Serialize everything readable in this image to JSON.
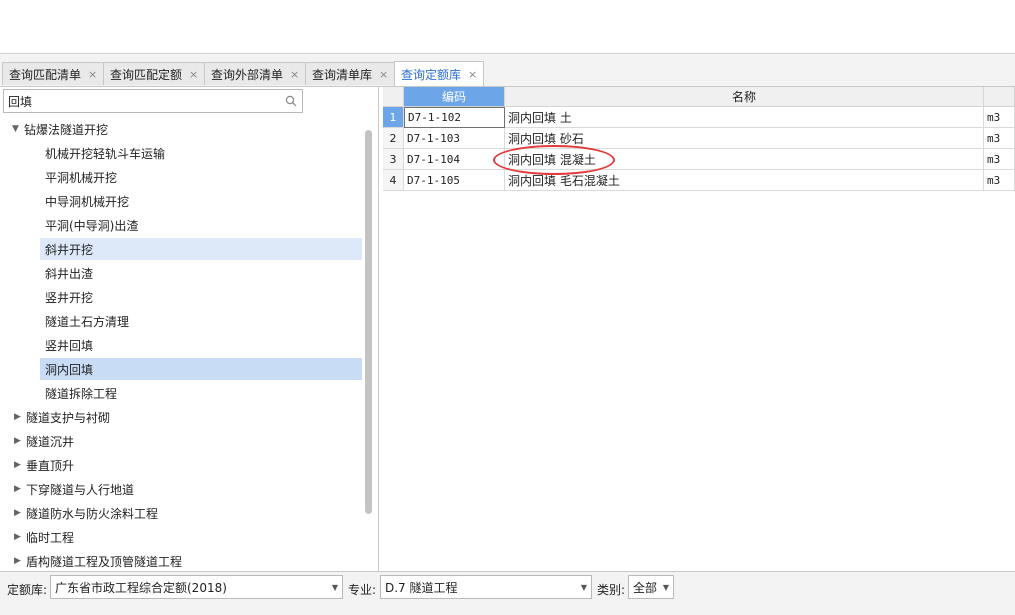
{
  "tabs": [
    {
      "label": "查询匹配清单",
      "active": false
    },
    {
      "label": "查询匹配定额",
      "active": false
    },
    {
      "label": "查询外部清单",
      "active": false
    },
    {
      "label": "查询清单库",
      "active": false
    },
    {
      "label": "查询定额库",
      "active": true
    }
  ],
  "tab_close": "×",
  "search": {
    "value": "回填",
    "icon": "search-icon"
  },
  "tree": {
    "expanded_group": "钻爆法隧道开挖",
    "children": [
      "机械开挖轻轨斗车运输",
      "平洞机械开挖",
      "中导洞机械开挖",
      "平洞(中导洞)出渣",
      "斜井开挖",
      "斜井出渣",
      "竖井开挖",
      "隧道土石方清理",
      "竖井回填",
      "洞内回填",
      "隧道拆除工程"
    ],
    "hovered_child": "斜井开挖",
    "selected_child": "洞内回填",
    "collapsed_groups": [
      "隧道支护与衬砌",
      "隧道沉井",
      "垂直顶升",
      "下穿隧道与人行地道",
      "隧道防水与防火涂料工程",
      "临时工程",
      "盾构隧道工程及顶管隧道工程"
    ]
  },
  "grid": {
    "headers": {
      "code": "编码",
      "name": "名称"
    },
    "rows": [
      {
        "num": "1",
        "code": "D7-1-102",
        "name": "洞内回填 土",
        "unit": "m3"
      },
      {
        "num": "2",
        "code": "D7-1-103",
        "name": "洞内回填 砂石",
        "unit": "m3"
      },
      {
        "num": "3",
        "code": "D7-1-104",
        "name": "洞内回填 混凝土",
        "unit": "m3"
      },
      {
        "num": "4",
        "code": "D7-1-105",
        "name": "洞内回填 毛石混凝土",
        "unit": "m3"
      }
    ],
    "active_row": 1,
    "highlighted_row": 3,
    "highlight_color": "#e03a3a",
    "header_accent": "#6ca6e9"
  },
  "bottom": {
    "library_label": "定额库:",
    "library_value": "广东省市政工程综合定额(2018)",
    "specialty_label": "专业:",
    "specialty_value": "D.7 隧道工程",
    "category_label": "类别:",
    "category_value": "全部"
  }
}
